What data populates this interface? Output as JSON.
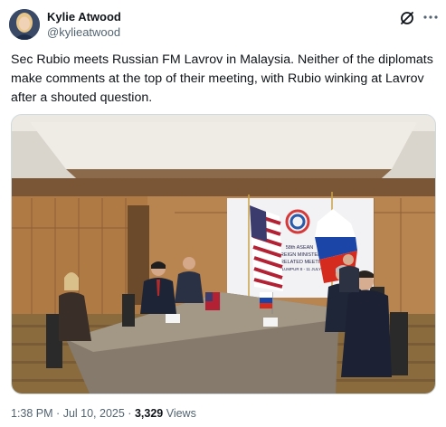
{
  "tweet": {
    "author_name": "Kylie Atwood",
    "author_handle": "@kylieatwood",
    "text": "Sec Rubio meets Russian FM Lavrov in Malaysia. Neither of the diplomats make comments at the top of their meeting, with Rubio winking at Lavrov after a shouted question.",
    "time": "1:38 PM",
    "separator": "·",
    "date": "Jul 10, 2025",
    "views_count": "3,329",
    "views_label": "Views"
  },
  "banner": {
    "line1": "58th ASEAN",
    "line2": "FOREIGN MINISTERS'",
    "line3": "AND RELATED MEETINGS",
    "line4": "KUALA LUMPUR 8 - 11 JULY 2025"
  },
  "icons": {
    "grok": "grok-icon",
    "more": "more-icon",
    "avatar": "avatar"
  },
  "colors": {
    "text": "#0f1419",
    "muted": "#536471",
    "border": "#cfd9de"
  }
}
